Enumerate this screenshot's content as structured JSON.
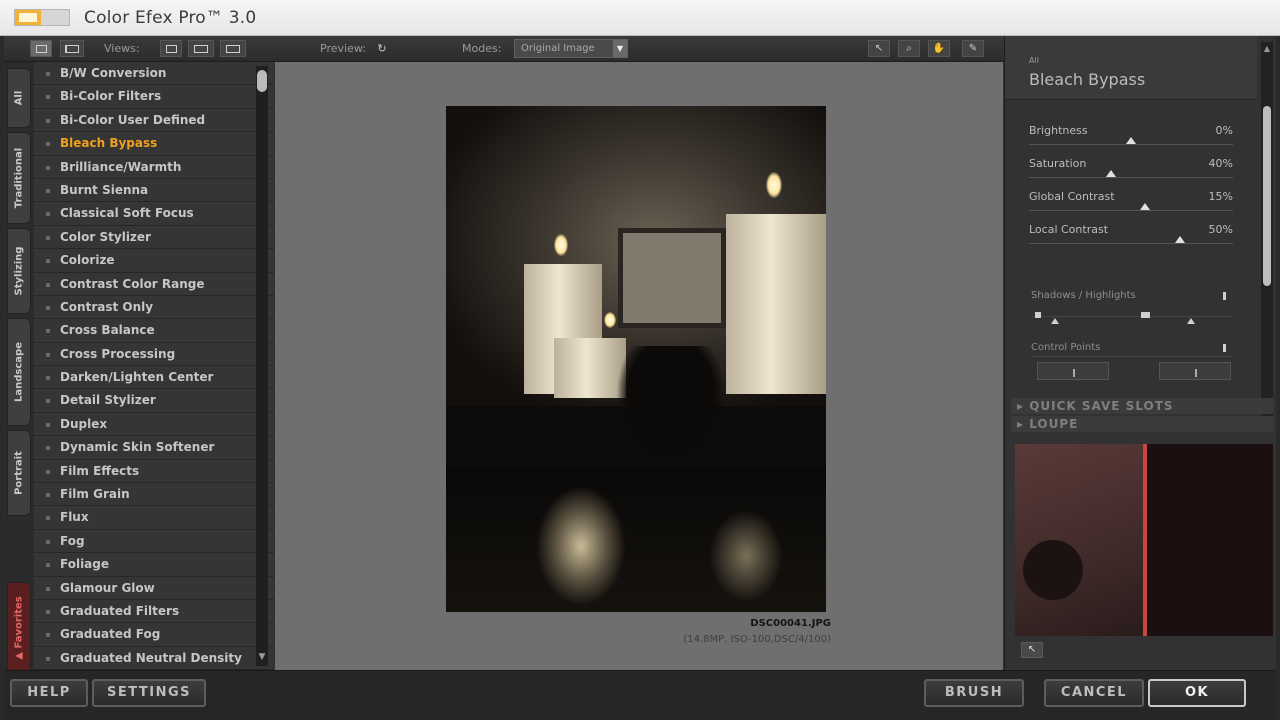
{
  "window": {
    "title": "Color Efex Pro™ 3.0"
  },
  "toolbar": {
    "views_label": "Views:",
    "preview_label": "Preview:",
    "modes_label": "Modes:",
    "mode_value": "Original Image"
  },
  "tabs": [
    {
      "label": "All"
    },
    {
      "label": "Traditional"
    },
    {
      "label": "Stylizing"
    },
    {
      "label": "Landscape"
    },
    {
      "label": "Portrait"
    },
    {
      "label": "▲ Favorites"
    }
  ],
  "filters": [
    "B/W Conversion",
    "Bi-Color Filters",
    "Bi-Color User Defined",
    "Bleach Bypass",
    "Brilliance/Warmth",
    "Burnt Sienna",
    "Classical Soft Focus",
    "Color Stylizer",
    "Colorize",
    "Contrast Color Range",
    "Contrast Only",
    "Cross Balance",
    "Cross Processing",
    "Darken/Lighten Center",
    "Detail Stylizer",
    "Duplex",
    "Dynamic Skin Softener",
    "Film Effects",
    "Film Grain",
    "Flux",
    "Fog",
    "Foliage",
    "Glamour Glow",
    "Graduated Filters",
    "Graduated Fog",
    "Graduated Neutral Density"
  ],
  "active_filter": "Bleach Bypass",
  "image": {
    "filename": "DSC00041.JPG",
    "meta": "(14.8MP, ISO-100,DSC/4/100)"
  },
  "panel": {
    "category": "All",
    "title": "Bleach Bypass",
    "sliders": [
      {
        "label": "Brightness",
        "value": "0%",
        "level": 0.5
      },
      {
        "label": "Saturation",
        "value": "40%",
        "level": 0.4
      },
      {
        "label": "Global Contrast",
        "value": "15%",
        "level": 0.57
      },
      {
        "label": "Local Contrast",
        "value": "50%",
        "level": 0.74
      }
    ],
    "shadows_label": "Shadows / Highlights",
    "control_points_label": "Control Points",
    "quick_save_label": "▸ QUICK SAVE SLOTS",
    "loupe_label": "▸ LOUPE"
  },
  "buttons": {
    "help": "HELP",
    "settings": "SETTINGS",
    "brush": "BRUSH",
    "cancel": "CANCEL",
    "ok": "OK"
  },
  "icons": {
    "view_single": "single-view-icon",
    "view_split": "split-view-icon",
    "zoom": "zoom-icon",
    "hand": "hand-icon",
    "pin": "pin-icon"
  }
}
